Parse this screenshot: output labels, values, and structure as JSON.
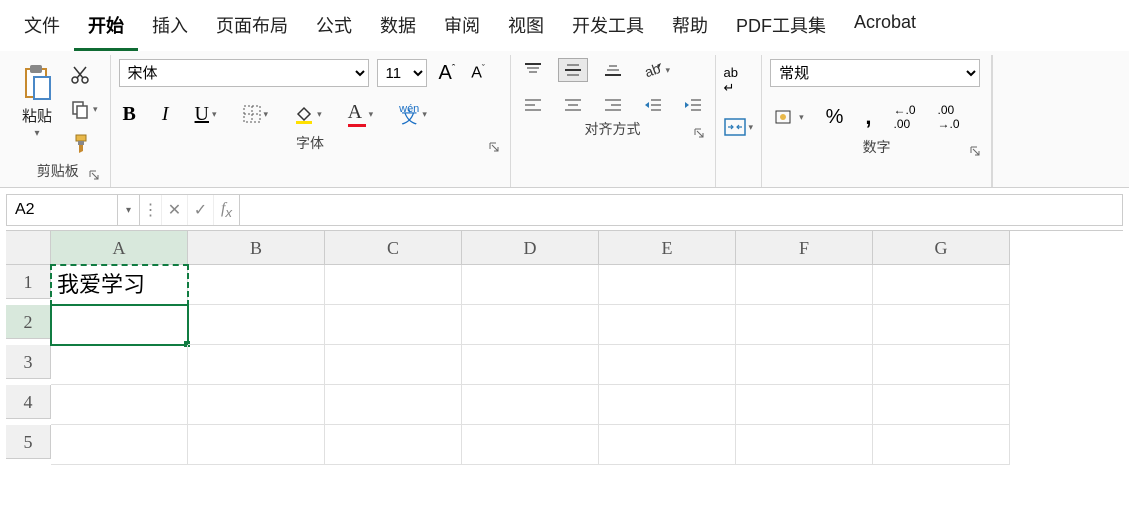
{
  "tabs": [
    "文件",
    "开始",
    "插入",
    "页面布局",
    "公式",
    "数据",
    "审阅",
    "视图",
    "开发工具",
    "帮助",
    "PDF工具集",
    "Acrobat"
  ],
  "tabs_active_index": 1,
  "clipboard": {
    "paste_label": "粘贴",
    "group_label": "剪贴板"
  },
  "font": {
    "name": "宋体",
    "size": "11",
    "grow": "A",
    "shrink": "A",
    "bold": "B",
    "italic": "I",
    "underline": "U",
    "phonetic": "wén 文",
    "group_label": "字体"
  },
  "align": {
    "group_label": "对齐方式"
  },
  "wrap": {
    "label": "ab"
  },
  "number": {
    "format": "常规",
    "group_label": "数字"
  },
  "namebox": "A2",
  "formula": "",
  "columns": [
    "A",
    "B",
    "C",
    "D",
    "E",
    "F",
    "G"
  ],
  "rows": [
    "1",
    "2",
    "3",
    "4",
    "5"
  ],
  "cells": {
    "A1": "我爱学习"
  },
  "cut_cell": "A1",
  "selected_cell": "A2"
}
